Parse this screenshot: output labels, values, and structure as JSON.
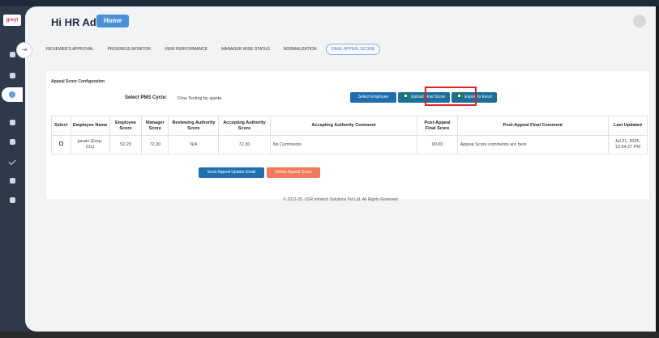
{
  "app": {
    "logo_text": "greyt"
  },
  "header": {
    "greeting": "Hi HR Admin",
    "home_label": "Home"
  },
  "tabs": [
    {
      "label": "REVIEWER'S APPROVAL"
    },
    {
      "label": "PROGRESS MONITOR"
    },
    {
      "label": "VIEW PERFORMANCE"
    },
    {
      "label": "MANAGER WISE STATUS"
    },
    {
      "label": "NORMALIZATION"
    },
    {
      "label": "FINAL APPEAL SCORE"
    }
  ],
  "card": {
    "title": "Appeal Score Configuration",
    "pms_label": "Select PMS Cycle:",
    "pms_value": "Flow Testing by ajanta",
    "select_employee": "Select Employee",
    "upload_final_score": "Upload Final Score",
    "export_excel": "Export to Excel"
  },
  "table": {
    "headers": [
      "Select",
      "Employee Name",
      "Employee Score",
      "Manager Score",
      "Reviewing Authority Score",
      "Accepting Authority Score",
      "Accepting Authority Comment",
      "Post-Appeal Final Score",
      "Post-Appeal Final Comment",
      "Last Updated"
    ],
    "rows": [
      {
        "employee_name": "janaki (Emp-011)",
        "employee_score": "52.20",
        "manager_score": "72.30",
        "reviewing_score": "N/A",
        "accepting_score": "72.30",
        "accepting_comment": "No Comments",
        "final_score": "90.00",
        "final_comment": "Appeal Score comments are here",
        "last_updated": "Jul 21, 2025, 12:54:27 PM"
      }
    ]
  },
  "actions": {
    "send_email": "Send Appeal Update Email",
    "delete_score": "Delete Appeal Score"
  },
  "footer": {
    "text": "© 2013-25, USR Infotech Solutions Pvt Ltd. All Rights Reserved"
  },
  "colors": {
    "primary": "#1f6fb0",
    "danger": "#f07a5a",
    "accent": "#4a90d9",
    "highlight": "#dd2222"
  }
}
